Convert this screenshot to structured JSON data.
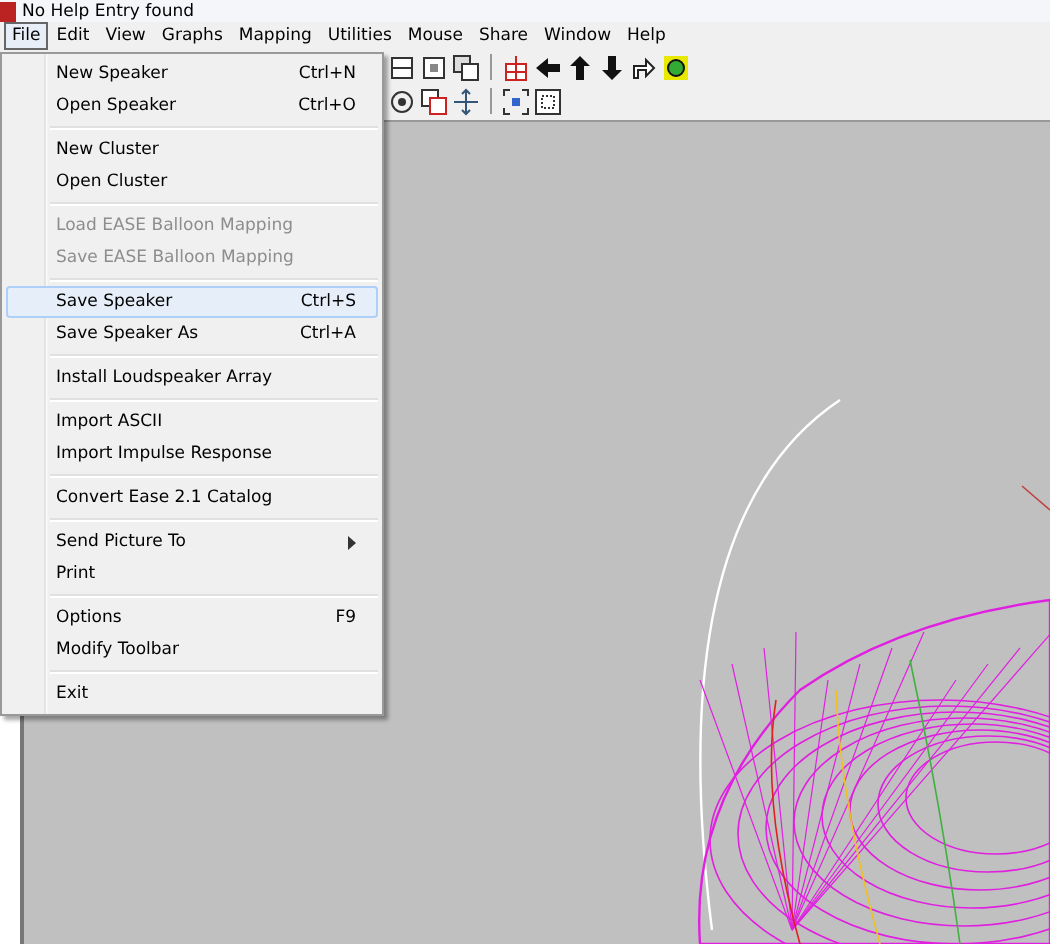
{
  "window": {
    "title": "No Help Entry found"
  },
  "menubar": [
    {
      "label": "File",
      "selected": true
    },
    {
      "label": "Edit",
      "selected": false
    },
    {
      "label": "View",
      "selected": false
    },
    {
      "label": "Graphs",
      "selected": false
    },
    {
      "label": "Mapping",
      "selected": false
    },
    {
      "label": "Utilities",
      "selected": false
    },
    {
      "label": "Mouse",
      "selected": false
    },
    {
      "label": "Share",
      "selected": false
    },
    {
      "label": "Window",
      "selected": false
    },
    {
      "label": "Help",
      "selected": false
    }
  ],
  "file_menu": [
    {
      "kind": "item",
      "label": "New Speaker",
      "shortcut": "Ctrl+N",
      "disabled": false,
      "selected": false
    },
    {
      "kind": "item",
      "label": "Open Speaker",
      "shortcut": "Ctrl+O",
      "disabled": false,
      "selected": false
    },
    {
      "kind": "separator"
    },
    {
      "kind": "item",
      "label": "New Cluster",
      "disabled": false,
      "selected": false
    },
    {
      "kind": "item",
      "label": "Open Cluster",
      "disabled": false,
      "selected": false
    },
    {
      "kind": "separator"
    },
    {
      "kind": "item",
      "label": "Load EASE Balloon Mapping",
      "disabled": true,
      "selected": false
    },
    {
      "kind": "item",
      "label": "Save EASE Balloon Mapping",
      "disabled": true,
      "selected": false
    },
    {
      "kind": "separator"
    },
    {
      "kind": "item",
      "label": "Save Speaker",
      "shortcut": "Ctrl+S",
      "disabled": false,
      "selected": true
    },
    {
      "kind": "item",
      "label": "Save Speaker As",
      "shortcut": "Ctrl+A",
      "disabled": false,
      "selected": false
    },
    {
      "kind": "separator"
    },
    {
      "kind": "item",
      "label": "Install Loudspeaker Array",
      "disabled": false,
      "selected": false
    },
    {
      "kind": "separator"
    },
    {
      "kind": "item",
      "label": "Import ASCII",
      "disabled": false,
      "selected": false
    },
    {
      "kind": "item",
      "label": "Import Impulse Response",
      "disabled": false,
      "selected": false
    },
    {
      "kind": "separator"
    },
    {
      "kind": "item",
      "label": "Convert Ease 2.1 Catalog",
      "disabled": false,
      "selected": false
    },
    {
      "kind": "separator"
    },
    {
      "kind": "item",
      "label": "Send Picture To",
      "disabled": false,
      "selected": false,
      "submenu": true
    },
    {
      "kind": "item",
      "label": "Print",
      "disabled": false,
      "selected": false
    },
    {
      "kind": "separator"
    },
    {
      "kind": "item",
      "label": "Options",
      "shortcut": "F9",
      "disabled": false,
      "selected": false
    },
    {
      "kind": "item",
      "label": "Modify Toolbar",
      "disabled": false,
      "selected": false
    },
    {
      "kind": "separator"
    },
    {
      "kind": "item",
      "label": "Exit",
      "disabled": false,
      "selected": false
    }
  ]
}
